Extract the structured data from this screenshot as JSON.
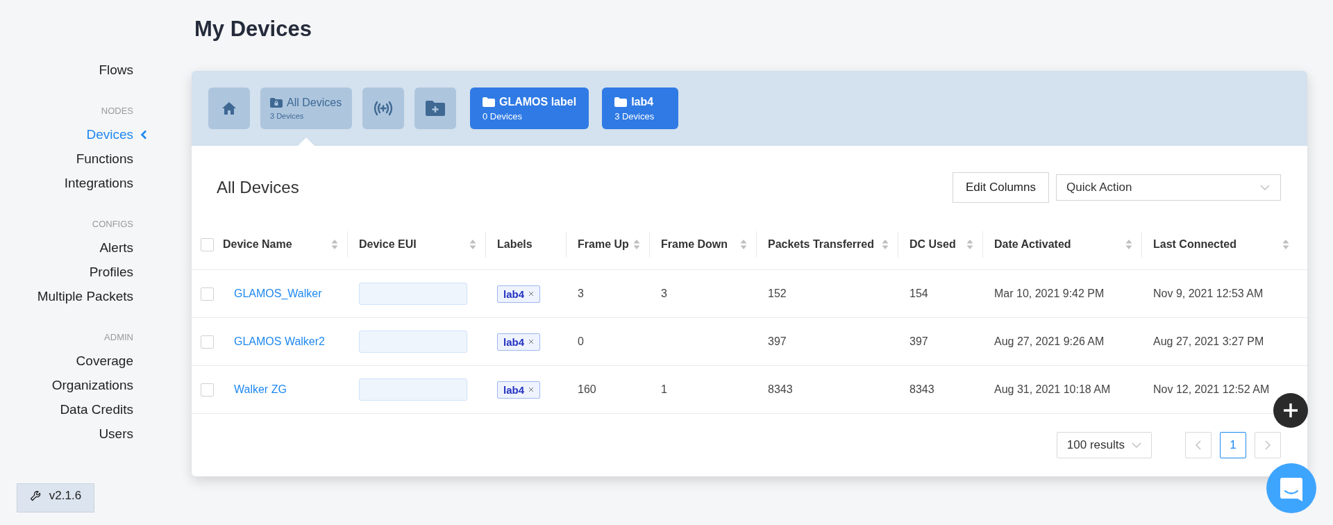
{
  "page_title": "My Devices",
  "sidebar": {
    "sections": [
      {
        "items": [
          {
            "label": "Flows",
            "selected": false
          }
        ]
      },
      {
        "heading": "NODES",
        "items": [
          {
            "label": "Devices",
            "selected": true
          },
          {
            "label": "Functions",
            "selected": false
          },
          {
            "label": "Integrations",
            "selected": false
          }
        ]
      },
      {
        "heading": "CONFIGS",
        "items": [
          {
            "label": "Alerts",
            "selected": false
          },
          {
            "label": "Profiles",
            "selected": false
          },
          {
            "label": "Multiple Packets",
            "selected": false
          }
        ]
      },
      {
        "heading": "ADMIN",
        "items": [
          {
            "label": "Coverage",
            "selected": false
          },
          {
            "label": "Organizations",
            "selected": false
          },
          {
            "label": "Data Credits",
            "selected": false
          },
          {
            "label": "Users",
            "selected": false
          }
        ]
      }
    ],
    "version": "v2.1.6"
  },
  "toolbar": [
    {
      "kind": "home",
      "selected": false
    },
    {
      "kind": "all",
      "label": "All Devices",
      "count": "3 Devices",
      "selected": true
    },
    {
      "kind": "signal",
      "selected": false
    },
    {
      "kind": "add-folder",
      "selected": false
    },
    {
      "kind": "label",
      "label": "GLAMOS label",
      "count": "0 Devices",
      "selected": false
    },
    {
      "kind": "label",
      "label": "lab4",
      "count": "3 Devices",
      "selected": false
    }
  ],
  "panel": {
    "title": "All Devices",
    "edit_columns": "Edit Columns",
    "quick_action": {
      "placeholder": "Quick Action"
    }
  },
  "table": {
    "columns": [
      {
        "label": "Device Name",
        "sortable": true
      },
      {
        "label": "Device EUI",
        "sortable": true
      },
      {
        "label": "Labels",
        "sortable": false
      },
      {
        "label": "Frame Up",
        "sortable": true
      },
      {
        "label": "Frame Down",
        "sortable": true
      },
      {
        "label": "Packets Transferred",
        "sortable": true
      },
      {
        "label": "DC Used",
        "sortable": true
      },
      {
        "label": "Date Activated",
        "sortable": true
      },
      {
        "label": "Last Connected",
        "sortable": true
      }
    ],
    "all_checked": false,
    "rows": [
      {
        "checked": false,
        "name": "GLAMOS_Walker",
        "labels": [
          "lab4"
        ],
        "frame_up": "3",
        "frame_down": "3",
        "packets": "152",
        "dc_used": "154",
        "date_activated": "Mar 10, 2021 9:42 PM",
        "last_connected": "Nov 9, 2021 12:53 AM"
      },
      {
        "checked": false,
        "name": "GLAMOS Walker2",
        "labels": [
          "lab4"
        ],
        "frame_up": "0",
        "packets": "397",
        "dc_used": "397",
        "date_activated": "Aug 27, 2021 9:26 AM",
        "last_connected": "Aug 27, 2021 3:27 PM"
      },
      {
        "checked": false,
        "name": "Walker ZG",
        "labels": [
          "lab4"
        ],
        "frame_up": "160",
        "frame_down": "1",
        "packets": "8343",
        "dc_used": "8343",
        "date_activated": "Aug 31, 2021 10:18 AM",
        "last_connected": "Nov 12, 2021 12:52 AM"
      }
    ]
  },
  "pagination": {
    "page_size": "100 results",
    "pages": [
      {
        "label": "1",
        "selected": true
      }
    ]
  }
}
